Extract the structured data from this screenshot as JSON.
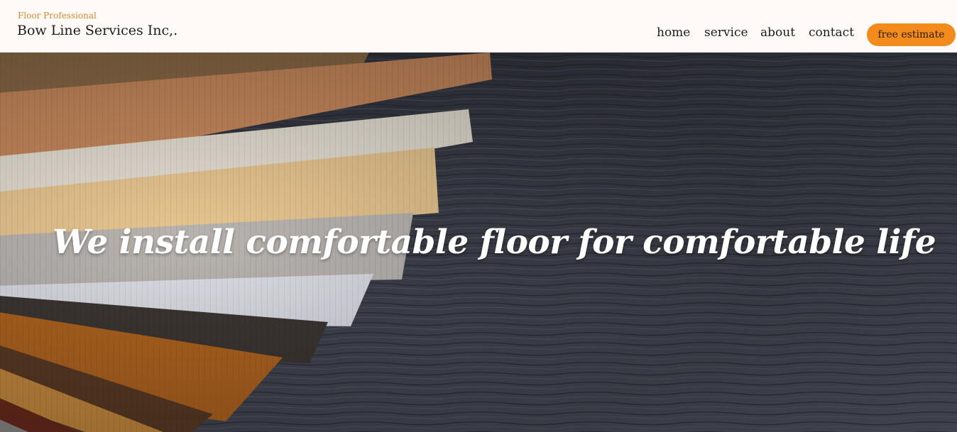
{
  "header": {
    "tagline": "Floor Professional",
    "company_name": "Bow Line Services Inc,.",
    "nav": {
      "home": "home",
      "service": "service",
      "about": "about",
      "contact": "contact"
    },
    "cta_label": "free estimate"
  },
  "hero": {
    "headline": "We install comfortable floor for comfortable life"
  },
  "colors": {
    "accent": "#f38a1c",
    "tagline": "#d98a2c",
    "header_bg": "#fffaf8",
    "wood_dark_bg": "#3c3f4a"
  }
}
